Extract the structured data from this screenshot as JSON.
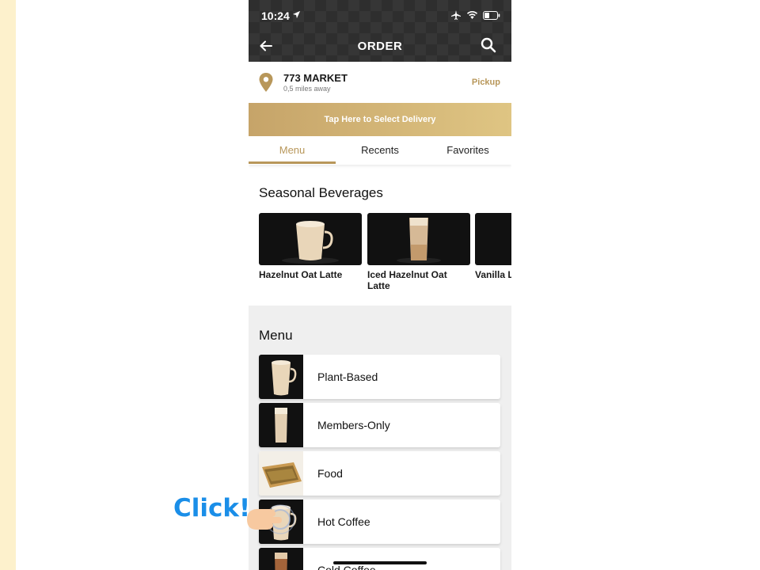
{
  "status_bar": {
    "time": "10:24"
  },
  "header": {
    "title": "ORDER"
  },
  "store": {
    "name": "773 MARKET",
    "distance": "0,5 miles away",
    "mode_label": "Pickup"
  },
  "delivery_banner": {
    "label": "Tap Here to Select Delivery"
  },
  "tabs": [
    {
      "label": "Menu"
    },
    {
      "label": "Recents"
    },
    {
      "label": "Favorites"
    }
  ],
  "seasonal": {
    "title": "Seasonal Beverages",
    "items": [
      {
        "name": "Hazelnut Oat Latte"
      },
      {
        "name": "Iced Hazelnut Oat Latte"
      },
      {
        "name": "Vanilla Latte"
      }
    ]
  },
  "menu": {
    "title": "Menu",
    "items": [
      {
        "label": "Plant-Based"
      },
      {
        "label": "Members-Only"
      },
      {
        "label": "Food"
      },
      {
        "label": "Hot Coffee"
      },
      {
        "label": "Cold Coffee"
      }
    ]
  },
  "annotation": {
    "text": "Click!"
  },
  "colors": {
    "accent": "#b8975a",
    "click": "#1a8ee8",
    "topbar": "#2e2e2e"
  }
}
